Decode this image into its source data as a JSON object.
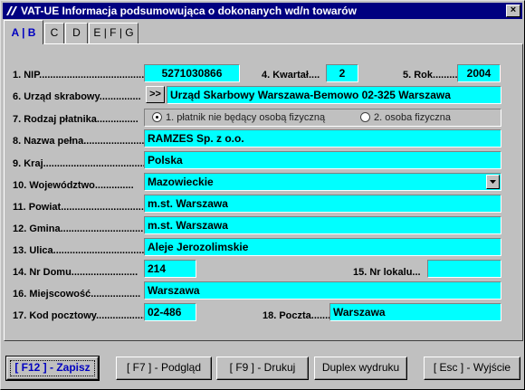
{
  "window": {
    "title": "VAT-UE Informacja podsumowująca o dokonanych wd/n towarów",
    "close_label": "×"
  },
  "tabs": [
    {
      "label": "A | B",
      "active": true
    },
    {
      "label": "C",
      "active": false
    },
    {
      "label": "D",
      "active": false
    },
    {
      "label": "E | F | G",
      "active": false
    }
  ],
  "form": {
    "nip": {
      "label": "1. NIP.......................................",
      "value": "5271030866"
    },
    "kwartal": {
      "label": "4. Kwartał....",
      "value": "2"
    },
    "rok": {
      "label": "5. Rok.........",
      "value": "2004"
    },
    "urzad": {
      "label": "6. Urząd skrabowy...............",
      "button": ">>",
      "value": "Urząd Skarbowy Warszawa-Bemowo  02-325  Warszawa"
    },
    "rodzaj": {
      "label": "7. Rodzaj płatnika...............",
      "options": [
        "1. płatnik nie będący osobą fizyczną",
        "2. osoba fizyczna"
      ],
      "selected_index": 0
    },
    "nazwa": {
      "label": "8. Nazwa pełna......................",
      "value": "RAMZES   Sp. z o.o."
    },
    "kraj": {
      "label": "9. Kraj..........................................",
      "value": "Polska"
    },
    "wojewodztwo": {
      "label": "10. Województwo..............",
      "value": "Mazowieckie"
    },
    "powiat": {
      "label": "11. Powiat.................................",
      "value": "m.st. Warszawa"
    },
    "gmina": {
      "label": "12. Gmina................................",
      "value": "m.st. Warszawa"
    },
    "ulica": {
      "label": "13. Ulica....................................",
      "value": "Aleje Jerozolimskie"
    },
    "nr_domu": {
      "label": "14. Nr Domu........................",
      "value": "214"
    },
    "nr_lokalu": {
      "label": "15. Nr lokalu...",
      "value": ""
    },
    "miejscowosc": {
      "label": "16. Miejscowość..................",
      "value": "Warszawa"
    },
    "kod": {
      "label": "17. Kod pocztowy..................",
      "value": "02-486"
    },
    "poczta": {
      "label": "18. Poczta.........",
      "value": "Warszawa"
    }
  },
  "buttons": {
    "save": "[ F12 ] - Zapisz",
    "preview": "[ F7 ] - Podgląd",
    "print": "[ F9 ] - Drukuj",
    "duplex": "Duplex wydruku",
    "exit": "[ Esc ] - Wyjście"
  },
  "colors": {
    "title_bg": "#000080",
    "field_bg": "#00ffff",
    "window_bg": "#c0c0c0",
    "active_tab_text": "#0000c0"
  },
  "icons": {
    "title": "app-icon",
    "close": "close-icon",
    "dropdown": "chevron-down-icon"
  }
}
